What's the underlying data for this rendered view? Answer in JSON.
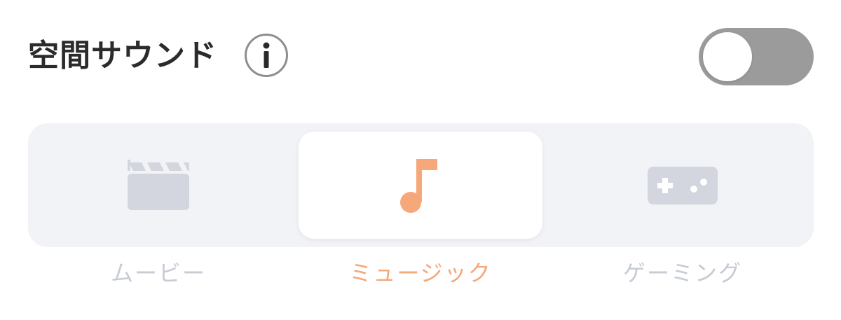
{
  "header": {
    "title": "空間サウンド",
    "info_icon": "info-icon"
  },
  "toggle": {
    "state": "off",
    "off_color": "#9b9b9b",
    "on_color": "#f7a87a"
  },
  "modes": {
    "items": [
      {
        "id": "movie",
        "label": "ムービー",
        "icon": "clapperboard-icon"
      },
      {
        "id": "music",
        "label": "ミュージック",
        "icon": "music-note-icon"
      },
      {
        "id": "gaming",
        "label": "ゲーミング",
        "icon": "gamepad-icon"
      }
    ],
    "selected": "music"
  },
  "colors": {
    "accent": "#f7a87a",
    "inactive_icon": "#d3d6de",
    "inactive_label": "#c7cbd4",
    "segment_bg": "#f2f3f6",
    "title_text": "#2b2b2b"
  }
}
